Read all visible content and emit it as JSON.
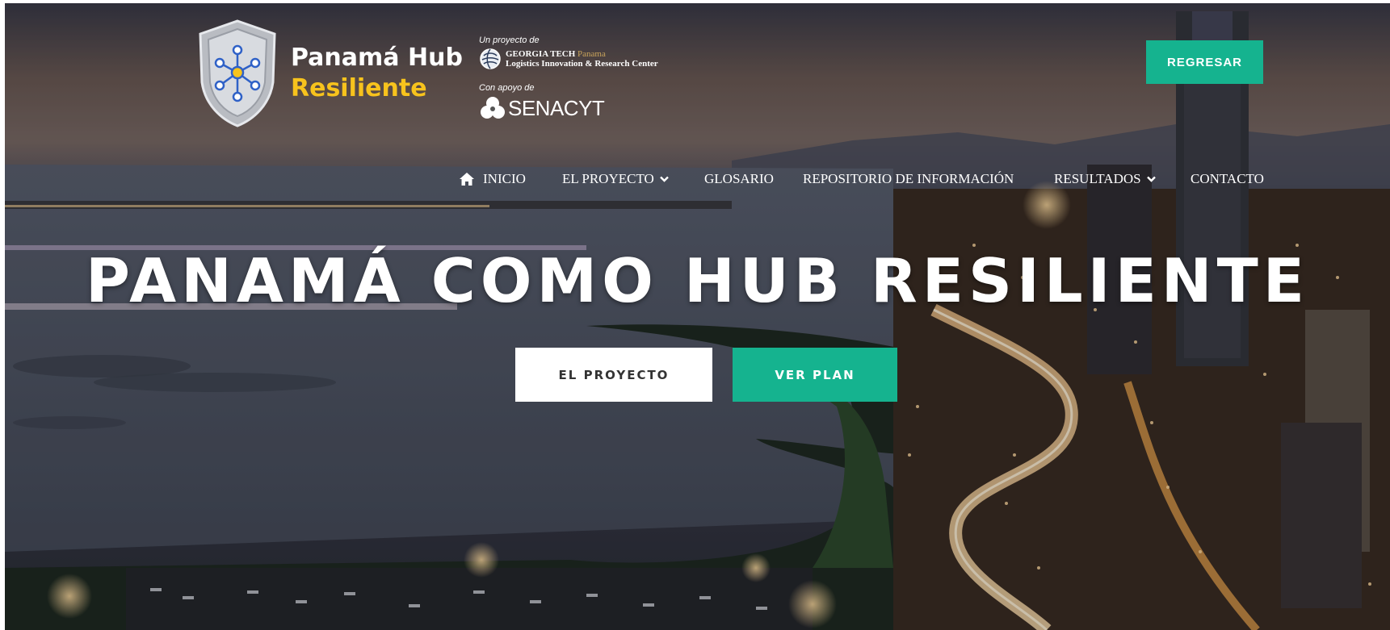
{
  "logo": {
    "line1": "Panamá Hub",
    "line2": "Resiliente"
  },
  "partners": {
    "project_caption": "Un proyecto de",
    "gt_name": "GEORGIA TECH",
    "gt_location": "Panama",
    "gt_center": "Logistics Innovation & Research Center",
    "support_caption": "Con apoyo de",
    "senacyt": "SENACYT"
  },
  "header": {
    "back_button": "REGRESAR"
  },
  "nav": {
    "items": [
      {
        "label": "INICIO",
        "icon": "home-icon"
      },
      {
        "label": "EL PROYECTO",
        "icon": "chevron-down-icon"
      },
      {
        "label": "GLOSARIO"
      },
      {
        "label": "REPOSITORIO DE INFORMACIÓN"
      },
      {
        "label": "RESULTADOS",
        "icon": "chevron-down-icon"
      },
      {
        "label": "CONTACTO"
      }
    ]
  },
  "hero": {
    "title": "PANAMÁ COMO HUB RESILIENTE",
    "primary_button": "EL PROYECTO",
    "secondary_button": "VER PLAN"
  },
  "colors": {
    "accent": "#15b38f",
    "logo_yellow": "#f7c31d"
  }
}
